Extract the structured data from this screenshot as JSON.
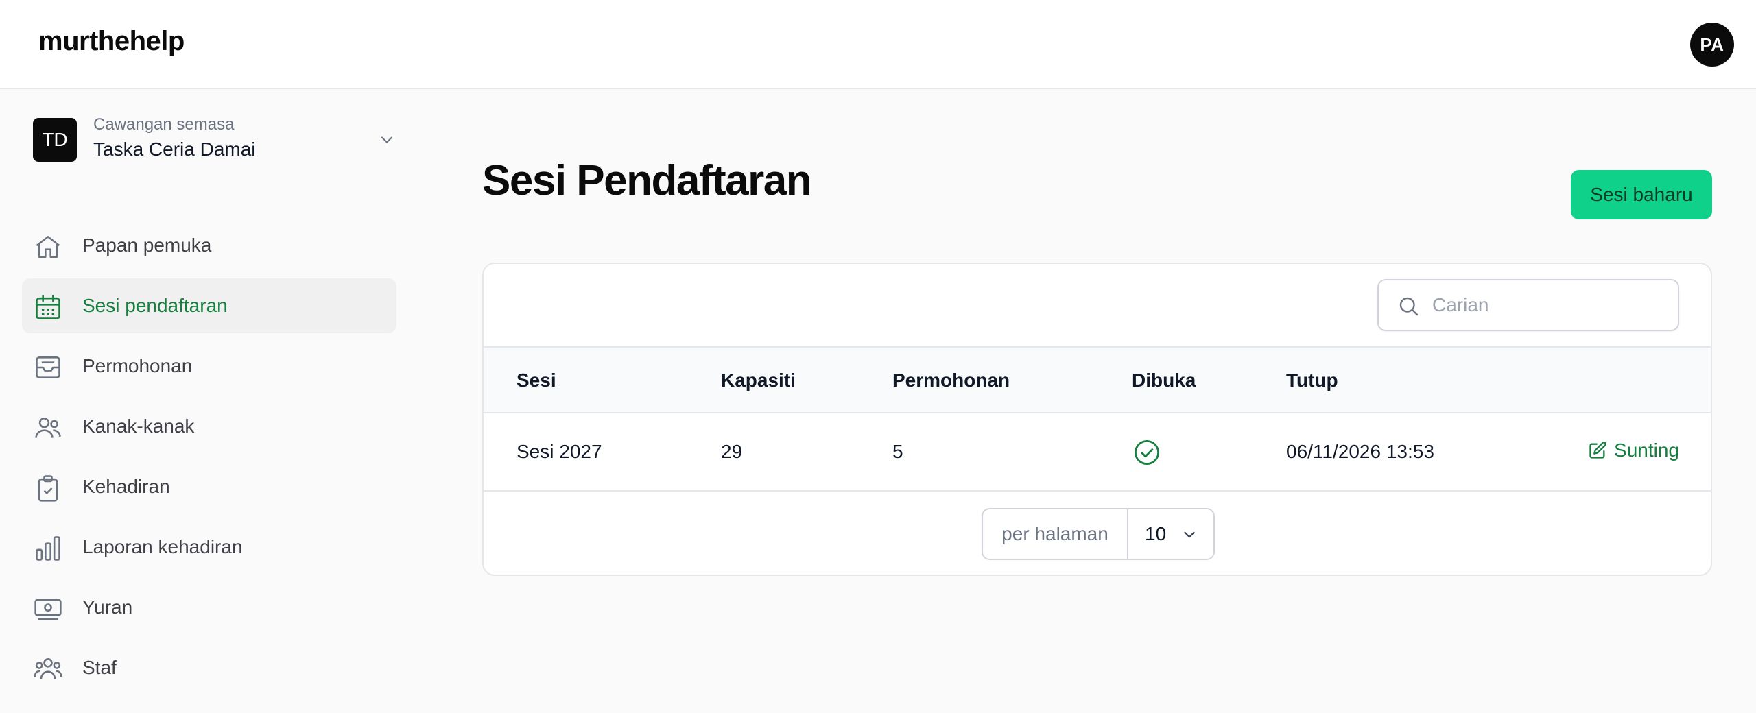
{
  "app": {
    "logo": "murthehelp",
    "user_initials": "PA"
  },
  "branch": {
    "badge": "TD",
    "subtitle": "Cawangan semasa",
    "name": "Taska Ceria Damai"
  },
  "sidebar": {
    "items": [
      {
        "label": "Papan pemuka",
        "icon": "home-icon",
        "active": false
      },
      {
        "label": "Sesi pendaftaran",
        "icon": "calendar-icon",
        "active": true
      },
      {
        "label": "Permohonan",
        "icon": "inbox-icon",
        "active": false
      },
      {
        "label": "Kanak-kanak",
        "icon": "users-icon",
        "active": false
      },
      {
        "label": "Kehadiran",
        "icon": "clipboard-check-icon",
        "active": false
      },
      {
        "label": "Laporan kehadiran",
        "icon": "bar-chart-icon",
        "active": false
      },
      {
        "label": "Yuran",
        "icon": "banknotes-icon",
        "active": false
      },
      {
        "label": "Staf",
        "icon": "user-group-icon",
        "active": false
      }
    ]
  },
  "main": {
    "title": "Sesi Pendaftaran",
    "new_button": "Sesi baharu",
    "search": {
      "placeholder": "Carian",
      "value": ""
    },
    "table": {
      "headers": {
        "session": "Sesi",
        "capacity": "Kapasiti",
        "applications": "Permohonan",
        "open": "Dibuka",
        "close": "Tutup"
      },
      "rows": [
        {
          "session": "Sesi 2027",
          "capacity": "29",
          "applications": "5",
          "open": true,
          "close": "06/11/2026 13:53",
          "action": "Sunting"
        }
      ]
    },
    "pagination": {
      "label": "per halaman",
      "value": "10"
    }
  },
  "colors": {
    "accent": "#10d18a",
    "active_text": "#15803d",
    "dark": "#0b0b0b"
  }
}
